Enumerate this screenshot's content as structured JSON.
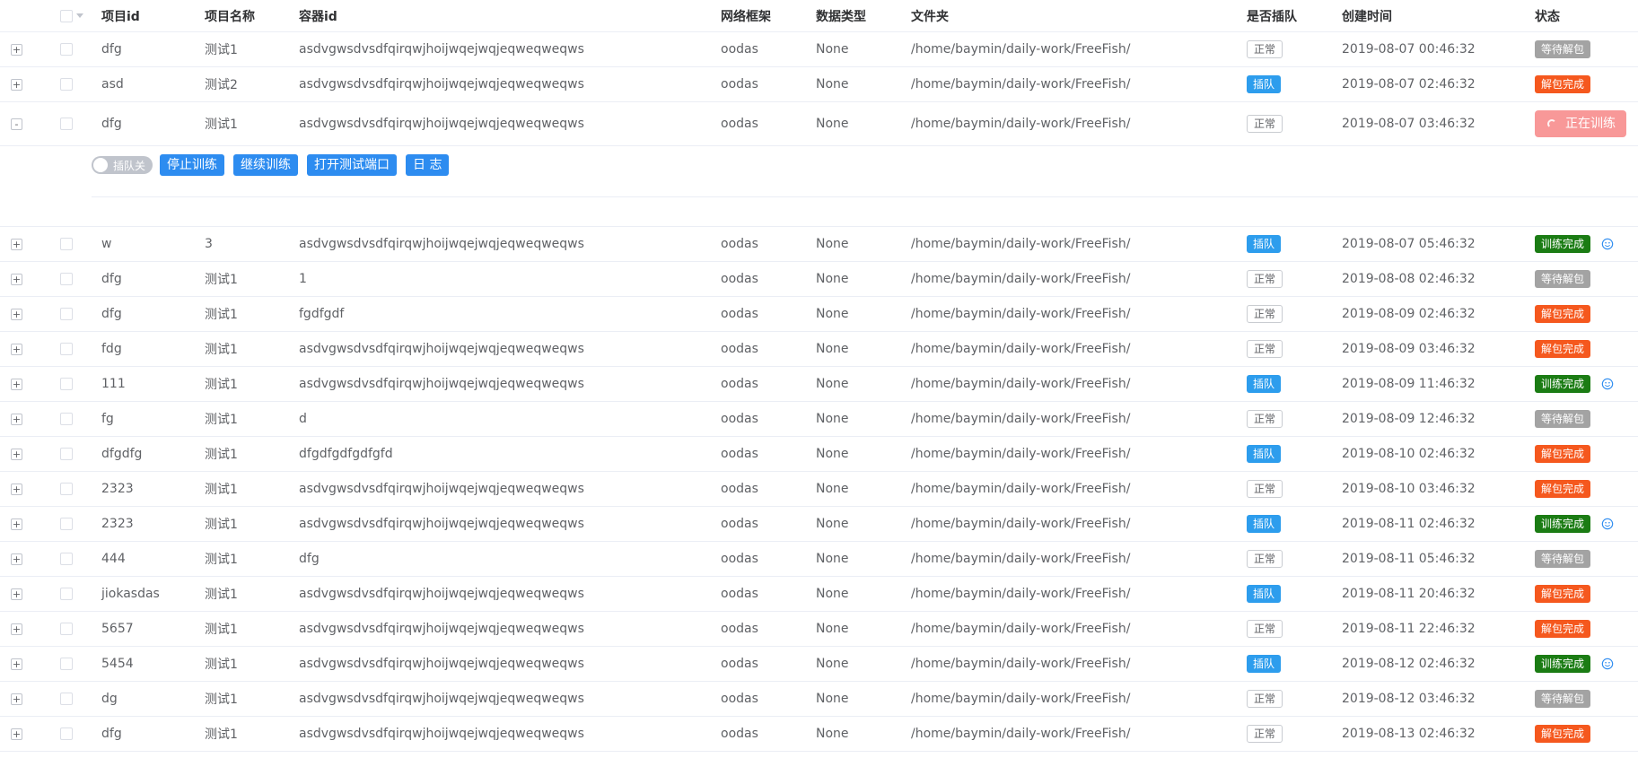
{
  "headers": {
    "project_id": "项目id",
    "project_name": "项目名称",
    "container_id": "容器id",
    "framework": "网络框架",
    "data_type": "数据类型",
    "folder": "文件夹",
    "queue": "是否插队",
    "created": "创建时间",
    "status": "状态"
  },
  "expanded_row_actions": {
    "switch_label": "插队关",
    "stop": "停止训练",
    "continue": "继续训练",
    "open_port": "打开测试端口",
    "log": "日 志"
  },
  "colors": {
    "queue_tag": "#2d9ded",
    "status_wait": "#a3a3a3",
    "status_unpacked": "#f5581e",
    "status_trained": "#1b7c14",
    "status_training": "#f89898",
    "button_primary": "#2d8cf0"
  },
  "rows": [
    {
      "expand": "+",
      "pid": "dfg",
      "pname": "测试1",
      "cid": "asdvgwsdvsdfqirqwjhoijwqejwqjeqweqweqws",
      "fw": "oodas",
      "dt": "None",
      "dir": "/home/baymin/daily-work/FreeFish/",
      "queue": "正常",
      "time": "2019-08-07 00:46:32",
      "status": "等待解包",
      "status_kind": "wait",
      "icon": false
    },
    {
      "expand": "+",
      "pid": "asd",
      "pname": "测试2",
      "cid": "asdvgwsdvsdfqirqwjhoijwqejwqjeqweqweqws",
      "fw": "oodas",
      "dt": "None",
      "dir": "/home/baymin/daily-work/FreeFish/",
      "queue": "插队",
      "time": "2019-08-07 02:46:32",
      "status": "解包完成",
      "status_kind": "unpack",
      "icon": false
    },
    {
      "expand": "-",
      "pid": "dfg",
      "pname": "测试1",
      "cid": "asdvgwsdvsdfqirqwjhoijwqejwqjeqweqweqws",
      "fw": "oodas",
      "dt": "None",
      "dir": "/home/baymin/daily-work/FreeFish/",
      "queue": "正常",
      "time": "2019-08-07 03:46:32",
      "status": "正在训练",
      "status_kind": "training",
      "icon": false,
      "expanded": true
    },
    {
      "expand": "+",
      "pid": "w",
      "pname": "3",
      "cid": "asdvgwsdvsdfqirqwjhoijwqejwqjeqweqweqws",
      "fw": "oodas",
      "dt": "None",
      "dir": "/home/baymin/daily-work/FreeFish/",
      "queue": "插队",
      "time": "2019-08-07 05:46:32",
      "status": "训练完成",
      "status_kind": "done",
      "icon": true
    },
    {
      "expand": "+",
      "pid": "dfg",
      "pname": "测试1",
      "cid": "1",
      "fw": "oodas",
      "dt": "None",
      "dir": "/home/baymin/daily-work/FreeFish/",
      "queue": "正常",
      "time": "2019-08-08 02:46:32",
      "status": "等待解包",
      "status_kind": "wait",
      "icon": false
    },
    {
      "expand": "+",
      "pid": "dfg",
      "pname": "测试1",
      "cid": "fgdfgdf",
      "fw": "oodas",
      "dt": "None",
      "dir": "/home/baymin/daily-work/FreeFish/",
      "queue": "正常",
      "time": "2019-08-09 02:46:32",
      "status": "解包完成",
      "status_kind": "unpack",
      "icon": false
    },
    {
      "expand": "+",
      "pid": "fdg",
      "pname": "测试1",
      "cid": "asdvgwsdvsdfqirqwjhoijwqejwqjeqweqweqws",
      "fw": "oodas",
      "dt": "None",
      "dir": "/home/baymin/daily-work/FreeFish/",
      "queue": "正常",
      "time": "2019-08-09 03:46:32",
      "status": "解包完成",
      "status_kind": "unpack",
      "icon": false
    },
    {
      "expand": "+",
      "pid": "111",
      "pname": "测试1",
      "cid": "asdvgwsdvsdfqirqwjhoijwqejwqjeqweqweqws",
      "fw": "oodas",
      "dt": "None",
      "dir": "/home/baymin/daily-work/FreeFish/",
      "queue": "插队",
      "time": "2019-08-09 11:46:32",
      "status": "训练完成",
      "status_kind": "done",
      "icon": true
    },
    {
      "expand": "+",
      "pid": "fg",
      "pname": "测试1",
      "cid": "d",
      "fw": "oodas",
      "dt": "None",
      "dir": "/home/baymin/daily-work/FreeFish/",
      "queue": "正常",
      "time": "2019-08-09 12:46:32",
      "status": "等待解包",
      "status_kind": "wait",
      "icon": false
    },
    {
      "expand": "+",
      "pid": "dfgdfg",
      "pname": "测试1",
      "cid": "dfgdfgdfgdfgfd",
      "fw": "oodas",
      "dt": "None",
      "dir": "/home/baymin/daily-work/FreeFish/",
      "queue": "插队",
      "time": "2019-08-10 02:46:32",
      "status": "解包完成",
      "status_kind": "unpack",
      "icon": false
    },
    {
      "expand": "+",
      "pid": "2323",
      "pname": "测试1",
      "cid": "asdvgwsdvsdfqirqwjhoijwqejwqjeqweqweqws",
      "fw": "oodas",
      "dt": "None",
      "dir": "/home/baymin/daily-work/FreeFish/",
      "queue": "正常",
      "time": "2019-08-10 03:46:32",
      "status": "解包完成",
      "status_kind": "unpack",
      "icon": false
    },
    {
      "expand": "+",
      "pid": "2323",
      "pname": "测试1",
      "cid": "asdvgwsdvsdfqirqwjhoijwqejwqjeqweqweqws",
      "fw": "oodas",
      "dt": "None",
      "dir": "/home/baymin/daily-work/FreeFish/",
      "queue": "插队",
      "time": "2019-08-11 02:46:32",
      "status": "训练完成",
      "status_kind": "done",
      "icon": true
    },
    {
      "expand": "+",
      "pid": "444",
      "pname": "测试1",
      "cid": "dfg",
      "fw": "oodas",
      "dt": "None",
      "dir": "/home/baymin/daily-work/FreeFish/",
      "queue": "正常",
      "time": "2019-08-11 05:46:32",
      "status": "等待解包",
      "status_kind": "wait",
      "icon": false
    },
    {
      "expand": "+",
      "pid": "jiokasdas",
      "pname": "测试1",
      "cid": "asdvgwsdvsdfqirqwjhoijwqejwqjeqweqweqws",
      "fw": "oodas",
      "dt": "None",
      "dir": "/home/baymin/daily-work/FreeFish/",
      "queue": "插队",
      "time": "2019-08-11 20:46:32",
      "status": "解包完成",
      "status_kind": "unpack",
      "icon": false
    },
    {
      "expand": "+",
      "pid": "5657",
      "pname": "测试1",
      "cid": "asdvgwsdvsdfqirqwjhoijwqejwqjeqweqweqws",
      "fw": "oodas",
      "dt": "None",
      "dir": "/home/baymin/daily-work/FreeFish/",
      "queue": "正常",
      "time": "2019-08-11 22:46:32",
      "status": "解包完成",
      "status_kind": "unpack",
      "icon": false
    },
    {
      "expand": "+",
      "pid": "5454",
      "pname": "测试1",
      "cid": "asdvgwsdvsdfqirqwjhoijwqejwqjeqweqweqws",
      "fw": "oodas",
      "dt": "None",
      "dir": "/home/baymin/daily-work/FreeFish/",
      "queue": "插队",
      "time": "2019-08-12 02:46:32",
      "status": "训练完成",
      "status_kind": "done",
      "icon": true
    },
    {
      "expand": "+",
      "pid": "dg",
      "pname": "测试1",
      "cid": "asdvgwsdvsdfqirqwjhoijwqejwqjeqweqweqws",
      "fw": "oodas",
      "dt": "None",
      "dir": "/home/baymin/daily-work/FreeFish/",
      "queue": "正常",
      "time": "2019-08-12 03:46:32",
      "status": "等待解包",
      "status_kind": "wait",
      "icon": false
    },
    {
      "expand": "+",
      "pid": "dfg",
      "pname": "测试1",
      "cid": "asdvgwsdvsdfqirqwjhoijwqejwqjeqweqweqws",
      "fw": "oodas",
      "dt": "None",
      "dir": "/home/baymin/daily-work/FreeFish/",
      "queue": "正常",
      "time": "2019-08-13 02:46:32",
      "status": "解包完成",
      "status_kind": "unpack",
      "icon": false
    }
  ]
}
